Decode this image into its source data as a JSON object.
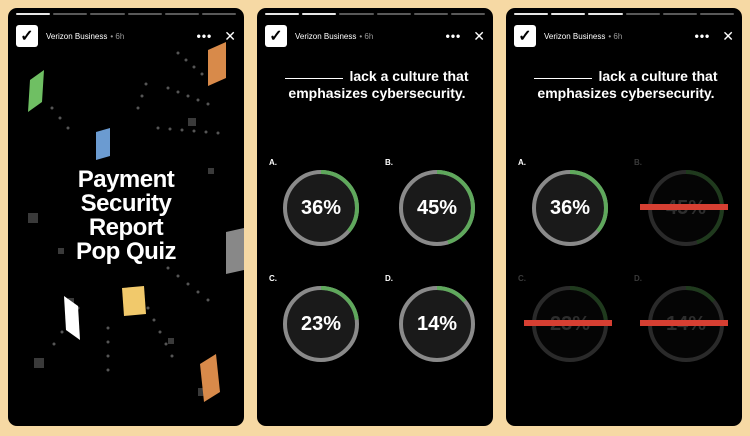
{
  "colors": {
    "background": "#f6d9a4",
    "story_bg": "#000000",
    "ring_track": "#8a8a8a",
    "ring_progress": "#5fa85c",
    "strike": "#d63f32"
  },
  "stories": [
    {
      "header": {
        "logo_icon": "verizon-check-logo-icon",
        "logo_glyph": "✓",
        "account": "Verizon Business",
        "meta": "• 6h",
        "more_glyph": "•••",
        "close_glyph": "✕"
      },
      "title_lines": [
        "Payment",
        "Security",
        "Report",
        "Pop Quiz"
      ]
    },
    {
      "header": {
        "logo_icon": "verizon-check-logo-icon",
        "logo_glyph": "✓",
        "account": "Verizon Business",
        "meta": "• 6h",
        "more_glyph": "•••",
        "close_glyph": "✕"
      },
      "question": "lack a culture that emphasizes cybersecurity.",
      "options": [
        {
          "letter": "A.",
          "value": "36%",
          "progress": 0.36
        },
        {
          "letter": "B.",
          "value": "45%",
          "progress": 0.45
        },
        {
          "letter": "C.",
          "value": "23%",
          "progress": 0.23
        },
        {
          "letter": "D.",
          "value": "14%",
          "progress": 0.14
        }
      ]
    },
    {
      "header": {
        "logo_icon": "verizon-check-logo-icon",
        "logo_glyph": "✓",
        "account": "Verizon Business",
        "meta": "• 6h",
        "more_glyph": "•••",
        "close_glyph": "✕"
      },
      "question": "lack a culture that emphasizes cybersecurity.",
      "options": [
        {
          "letter": "A.",
          "value": "36%",
          "progress": 0.36,
          "struck": false
        },
        {
          "letter": "B.",
          "value": "45%",
          "progress": 0.45,
          "struck": true
        },
        {
          "letter": "C.",
          "value": "23%",
          "progress": 0.23,
          "struck": true
        },
        {
          "letter": "D.",
          "value": "14%",
          "progress": 0.14,
          "struck": true
        }
      ]
    }
  ]
}
